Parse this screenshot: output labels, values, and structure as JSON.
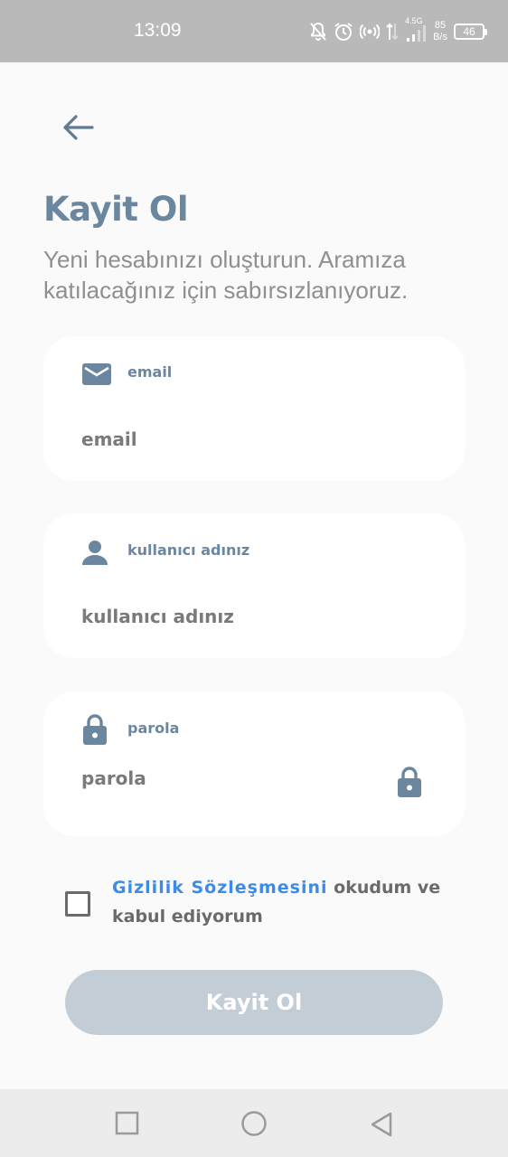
{
  "status_bar": {
    "time": "13:09",
    "network_type": "4.5G",
    "speed_value": "85",
    "speed_unit": "B/s",
    "battery": "46",
    "icons": [
      "bell-off-icon",
      "alarm-icon",
      "hotspot-icon",
      "data-arrows-icon",
      "signal-icon",
      "battery-icon"
    ]
  },
  "header": {
    "back_icon": "arrow-left-icon",
    "title": "Kayit Ol",
    "subtitle": "Yeni hesabınızı oluşturun. Aramıza katılacağınız  için sabırsızlanıyoruz."
  },
  "form": {
    "email": {
      "label": "email",
      "placeholder": "email",
      "value": "",
      "icon": "mail-icon"
    },
    "username": {
      "label": "kullanıcı adınız",
      "placeholder": "kullanıcı adınız",
      "value": "",
      "icon": "person-icon"
    },
    "password": {
      "label": "parola",
      "placeholder": "parola",
      "value": "",
      "icon": "lock-icon",
      "toggle_icon": "lock-icon"
    }
  },
  "agreement": {
    "checked": false,
    "link_text": "Gizlilik Sözleşmesini",
    "rest_text": " okudum ve kabul ediyorum"
  },
  "submit": {
    "label": "Kayit Ol",
    "enabled": false
  },
  "nav_bar": {
    "icons": [
      "square-recents-icon",
      "circle-home-icon",
      "triangle-back-icon"
    ]
  },
  "colors": {
    "accent": "#6b87a0",
    "link": "#3c8ce7",
    "button_disabled": "#c3cdd6",
    "card": "#ffffff",
    "background": "#fafafa"
  }
}
